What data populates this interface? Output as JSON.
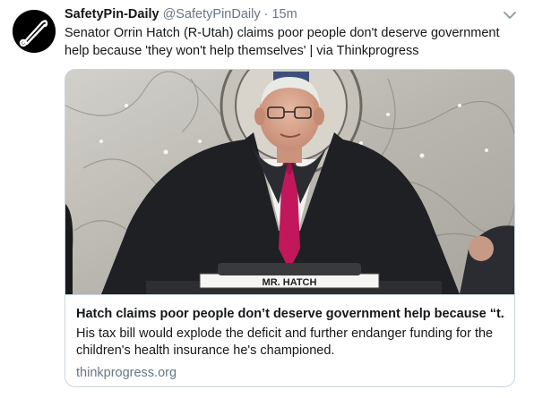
{
  "author": {
    "display_name": "SafetyPin-Daily",
    "handle": "@SafetyPinDaily",
    "separator": "·",
    "timestamp": "15m",
    "avatar_icon": "safety-pin-icon"
  },
  "tweet": {
    "text": "Senator Orrin Hatch (R-Utah) claims poor people don't deserve government help because 'they won't help themselves' | via Thinkprogress"
  },
  "card": {
    "title": "Hatch claims poor people don’t deserve government help because “t...",
    "description": "His tax bill would explode the deficit and further endanger funding for the children's health insurance he's championed.",
    "domain": "thinkprogress.org",
    "nameplate_text": "MR. HATCH"
  },
  "icons": {
    "more": "chevron-down-icon"
  },
  "colors": {
    "text": "#14171a",
    "secondary": "#657786",
    "border": "#ccd6dd",
    "tie": "#c2185b"
  }
}
